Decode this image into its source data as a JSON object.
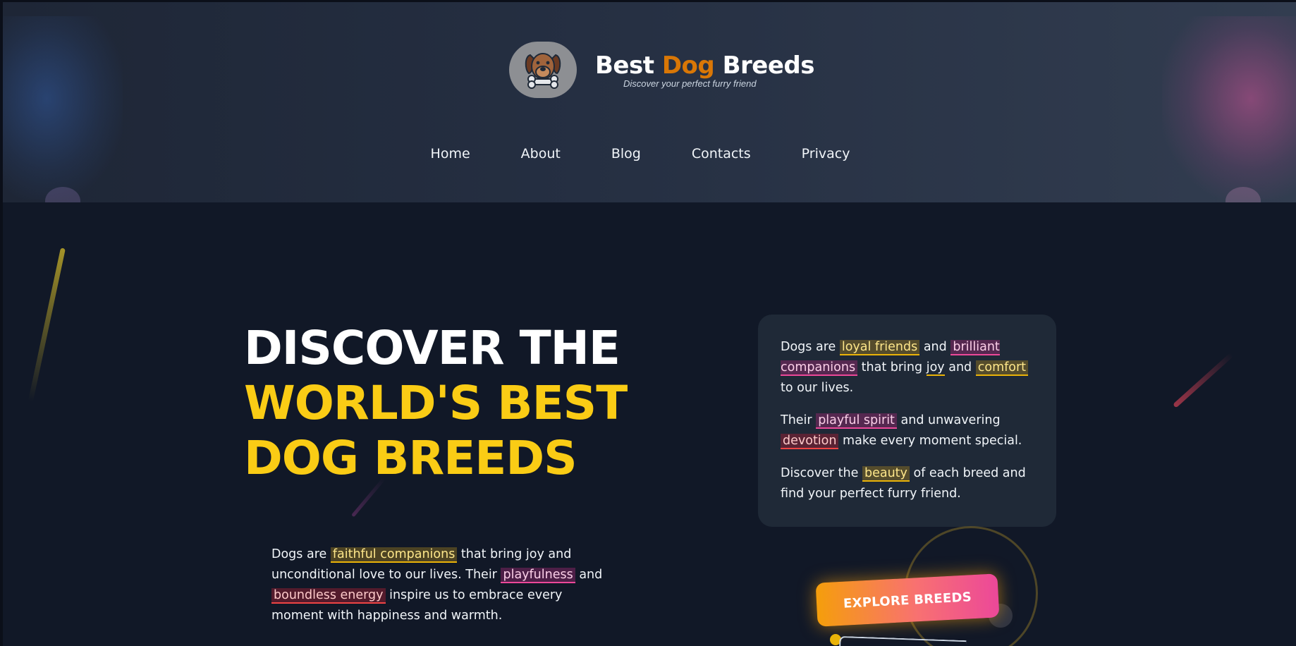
{
  "header": {
    "title_part1": "Best",
    "title_accent": "Dog",
    "title_part3": "Breeds",
    "subtitle": "Discover your perfect furry friend",
    "logo_icon": "dog-face-with-bone-icon",
    "accent_color": "#d97706"
  },
  "nav": {
    "items": [
      "Home",
      "About",
      "Blog",
      "Contacts",
      "Privacy"
    ]
  },
  "hero": {
    "title_line1": "DISCOVER THE",
    "title_line2": "WORLD'S BEST",
    "title_line3": "DOG BREEDS",
    "title_accent_color": "#facc15",
    "para": {
      "t1": "Dogs are",
      "hl1": "faithful companions",
      "t2": "that bring joy and unconditional love to our lives. Their",
      "hl2": "playfulness",
      "t3": "and",
      "hl3": "boundless energy",
      "t4": "inspire us to embrace every moment with happiness and warmth."
    }
  },
  "card": {
    "p1": {
      "t1": "Dogs are",
      "hl1": "loyal friends",
      "t2": "and",
      "hl2": "brilliant companions",
      "t3": "that bring",
      "hl3": "joy",
      "t4": "and",
      "hl4": "comfort",
      "t5": "to our lives."
    },
    "p2": {
      "t1": "Their",
      "hl1": "playful spirit",
      "t2": "and unwavering",
      "hl2": "devotion",
      "t3": "make every moment special."
    },
    "p3": {
      "t1": "Discover the",
      "hl1": "beauty",
      "t2": "of each breed and find your perfect furry friend."
    }
  },
  "cta": {
    "label": "EXPLORE BREEDS"
  }
}
